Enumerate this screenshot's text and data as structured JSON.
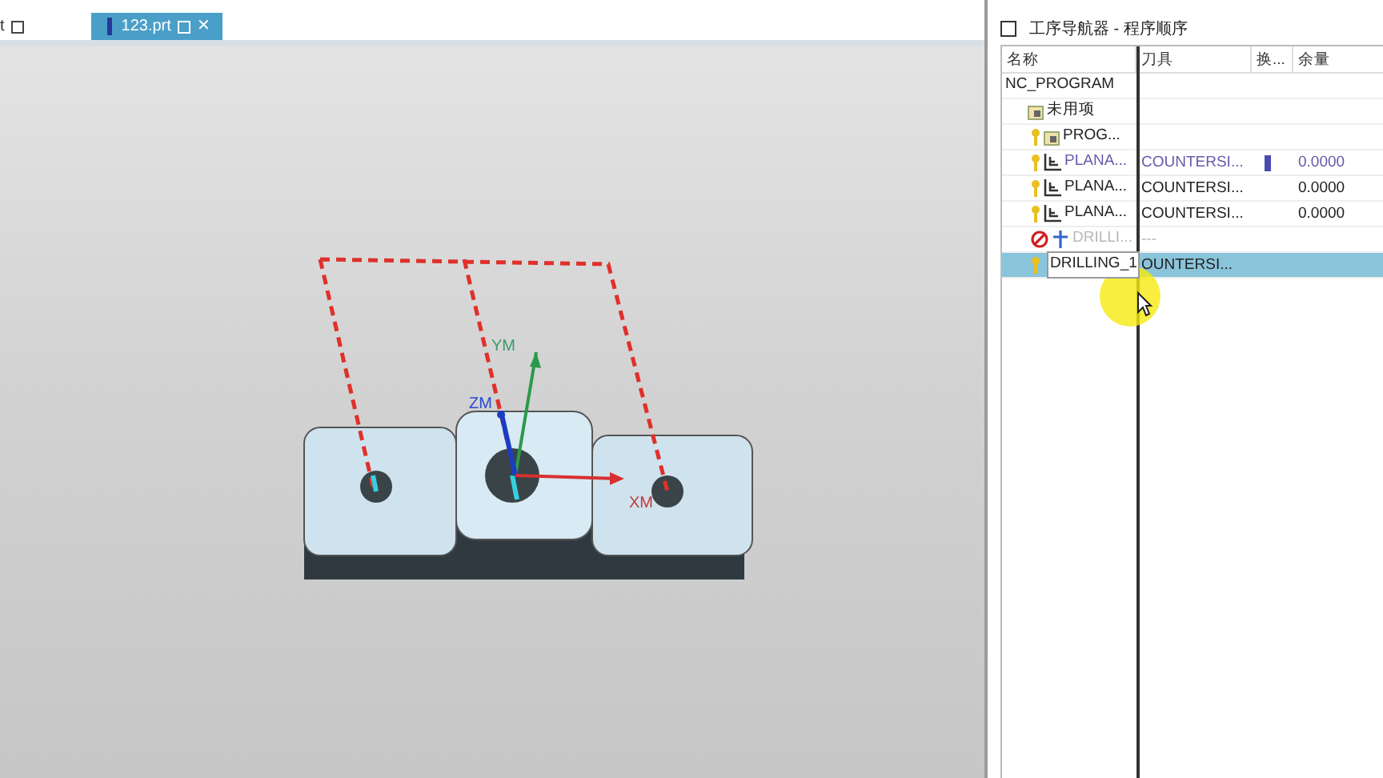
{
  "tabs": [
    {
      "label": "t",
      "selected": false
    },
    {
      "label": "123.prt",
      "selected": true,
      "close": "✕"
    }
  ],
  "viewport": {
    "axes": [
      "YM",
      "ZM",
      "XM"
    ]
  },
  "navigator": {
    "title": "工序导航器 - 程序顺序",
    "columns": [
      "名称",
      "刀具",
      "换...",
      "余量"
    ],
    "rows": [
      {
        "kind": "root",
        "name": "NC_PROGRAM",
        "tool": "",
        "stock": "",
        "marker": false,
        "highlighted": false,
        "disabled": false,
        "selected": false
      },
      {
        "kind": "group",
        "name": "未用项",
        "tool": "",
        "stock": "",
        "marker": false,
        "highlighted": false,
        "disabled": false,
        "selected": false
      },
      {
        "kind": "program",
        "name": "PROG...",
        "tool": "",
        "stock": "",
        "marker": false,
        "highlighted": false,
        "disabled": false,
        "selected": false
      },
      {
        "kind": "planar",
        "name": "PLANA...",
        "tool": "COUNTERSI...",
        "stock": "0.0000",
        "marker": true,
        "highlighted": true,
        "disabled": false,
        "selected": false
      },
      {
        "kind": "planar",
        "name": "PLANA...",
        "tool": "COUNTERSI...",
        "stock": "0.0000",
        "marker": false,
        "highlighted": false,
        "disabled": false,
        "selected": false
      },
      {
        "kind": "planar",
        "name": "PLANA...",
        "tool": "COUNTERSI...",
        "stock": "0.0000",
        "marker": false,
        "highlighted": false,
        "disabled": false,
        "selected": false
      },
      {
        "kind": "drill",
        "name": "DRILLI...",
        "tool": "---",
        "stock": "",
        "marker": false,
        "highlighted": false,
        "disabled": true,
        "selected": false
      },
      {
        "kind": "edit",
        "name": "DRILLING_1",
        "tool": "OUNTERSI...",
        "stock": "",
        "marker": false,
        "highlighted": false,
        "disabled": false,
        "selected": true
      }
    ]
  }
}
